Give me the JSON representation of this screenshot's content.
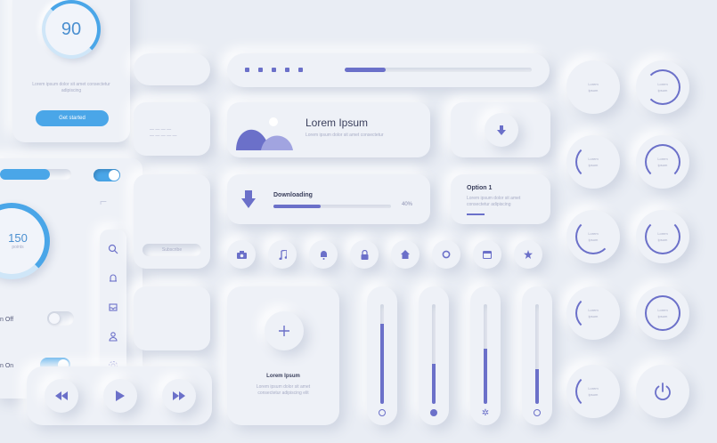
{
  "colors": {
    "accent": "#6b70c9",
    "blue": "#4aa6e8",
    "bg": "#e9edf4"
  },
  "score_card": {
    "value": "90",
    "desc": "Lorem ipsum dolor sit amet consectetur adipiscing",
    "button": "Get started"
  },
  "gauge": {
    "value": "150",
    "unit": "points"
  },
  "toggles": [
    {
      "label": "n Off",
      "state": "off"
    },
    {
      "label": "n On",
      "state": "on"
    }
  ],
  "image_card": {
    "title": "Lorem Ipsum",
    "desc": "Lorem ipsum dolor sit amet consectetur"
  },
  "download": {
    "label": "Downloading",
    "percent": "40%",
    "progress": 0.4
  },
  "option": {
    "title": "Option 1",
    "desc": "Lorem ipsum dolor sit amet consectetur adipiscing"
  },
  "add_card": {
    "title": "Lorem Ipsum",
    "desc": "Lorem ipsum dolor sit amet consectetur adipiscing elit"
  },
  "small_card": {
    "text": "Subscribe"
  },
  "dial_label": "Lorem ipsum",
  "icon_row": [
    "camera-icon",
    "music-icon",
    "bell-icon",
    "lock-icon",
    "home-icon",
    "gear-icon",
    "calendar-icon",
    "star-icon"
  ],
  "sidebar_icons": [
    "search-icon",
    "bell-icon",
    "inbox-icon",
    "user-icon",
    "gear-icon"
  ],
  "sliders": [
    0.8,
    0.4,
    0.55,
    0.35
  ],
  "playback": [
    "previous-icon",
    "play-icon",
    "next-icon"
  ]
}
